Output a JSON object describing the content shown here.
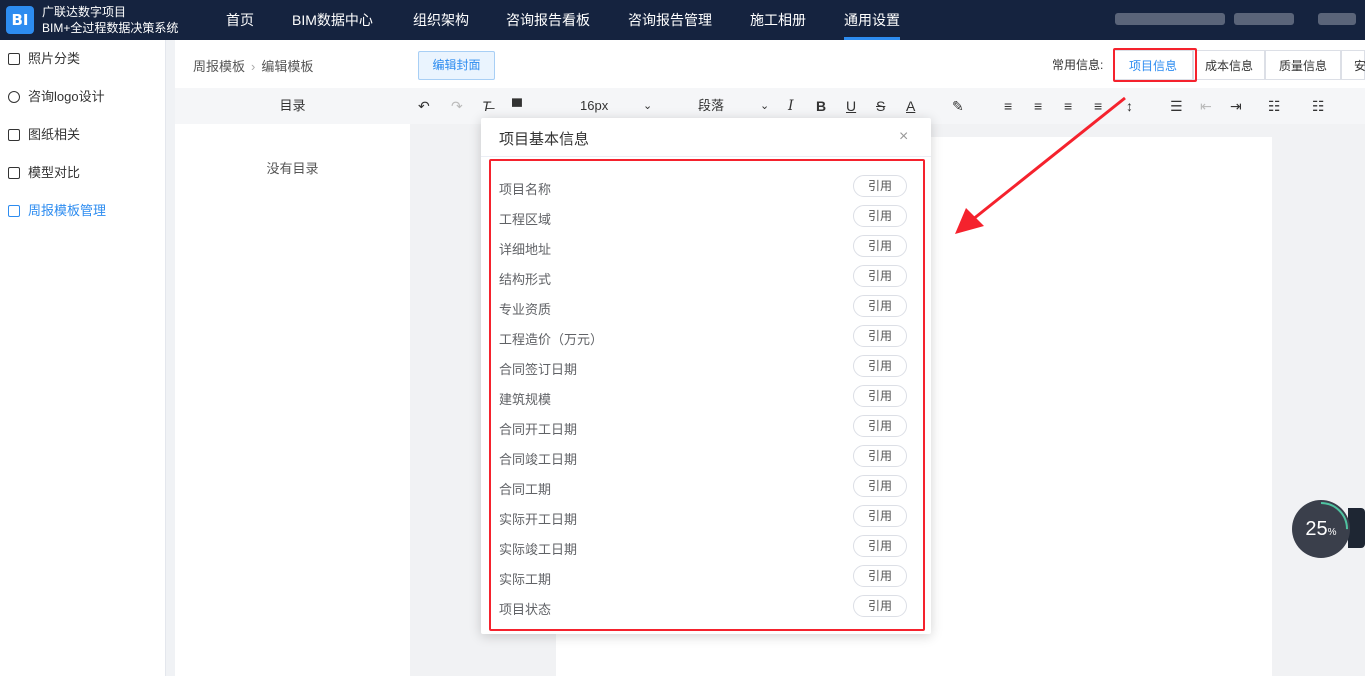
{
  "app": {
    "logo_text": "BI",
    "title_line1": "广联达数字项目",
    "title_line2": "BIM+全过程数据决策系统"
  },
  "nav": {
    "items": [
      {
        "label": "首页"
      },
      {
        "label": "BIM数据中心"
      },
      {
        "label": "组织架构"
      },
      {
        "label": "咨询报告看板"
      },
      {
        "label": "咨询报告管理"
      },
      {
        "label": "施工相册"
      },
      {
        "label": "通用设置"
      }
    ],
    "active_index": 6
  },
  "sidebar": {
    "items": [
      {
        "label": "照片分类",
        "icon": "folder-icon"
      },
      {
        "label": "咨询logo设计",
        "icon": "palette-icon"
      },
      {
        "label": "图纸相关",
        "icon": "edit-icon"
      },
      {
        "label": "模型对比",
        "icon": "building-icon"
      },
      {
        "label": "周报模板管理",
        "icon": "document-icon"
      }
    ],
    "active_index": 4
  },
  "breadcrumb": {
    "parent": "周报模板",
    "current": "编辑模板"
  },
  "header": {
    "edit_cover_label": "编辑封面",
    "common_info_label": "常用信息:",
    "tabs": [
      {
        "label": "项目信息"
      },
      {
        "label": "成本信息"
      },
      {
        "label": "质量信息"
      },
      {
        "label": "安"
      }
    ],
    "active_tab": 0
  },
  "toc": {
    "title": "目录",
    "empty_text": "没有目录"
  },
  "toolbar": {
    "font_size": "16px",
    "paragraph": "段落"
  },
  "popup": {
    "title": "项目基本信息",
    "close_glyph": "×",
    "ref_label": "引用",
    "fields": [
      {
        "label": "项目名称"
      },
      {
        "label": "工程区域"
      },
      {
        "label": "详细地址"
      },
      {
        "label": "结构形式"
      },
      {
        "label": "专业资质"
      },
      {
        "label": "工程造价（万元）"
      },
      {
        "label": "合同签订日期"
      },
      {
        "label": "建筑规模"
      },
      {
        "label": "合同开工日期"
      },
      {
        "label": "合同竣工日期"
      },
      {
        "label": "合同工期"
      },
      {
        "label": "实际开工日期"
      },
      {
        "label": "实际竣工日期"
      },
      {
        "label": "实际工期"
      },
      {
        "label": "项目状态"
      }
    ]
  },
  "progress": {
    "value": "25",
    "unit": "%",
    "fraction": 0.25
  },
  "colors": {
    "topbar": "#15233f",
    "accent": "#2d8cf0",
    "highlight": "#f5222d"
  }
}
